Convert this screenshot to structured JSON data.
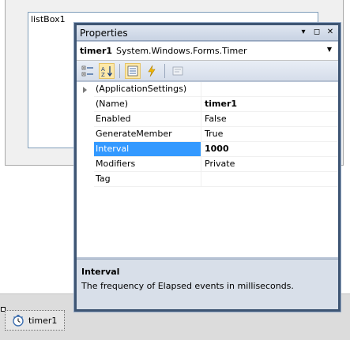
{
  "designer": {
    "listbox_label": "listBox1"
  },
  "tray": {
    "component_label": "timer1"
  },
  "properties": {
    "title": "Properties",
    "buttons": {
      "dropdown": "▾",
      "restore": "◻",
      "close": "✕"
    },
    "object_name": "timer1",
    "object_type": "System.Windows.Forms.Timer",
    "rows": [
      {
        "name": "(ApplicationSettings)",
        "value": ""
      },
      {
        "name": "(Name)",
        "value": "timer1"
      },
      {
        "name": "Enabled",
        "value": "False"
      },
      {
        "name": "GenerateMember",
        "value": "True"
      },
      {
        "name": "Interval",
        "value": "1000"
      },
      {
        "name": "Modifiers",
        "value": "Private"
      },
      {
        "name": "Tag",
        "value": ""
      }
    ],
    "description_title": "Interval",
    "description_text": "The frequency of Elapsed events in milliseconds."
  },
  "colors": {
    "selection": "#3399ff",
    "window_border": "#3e5573"
  }
}
